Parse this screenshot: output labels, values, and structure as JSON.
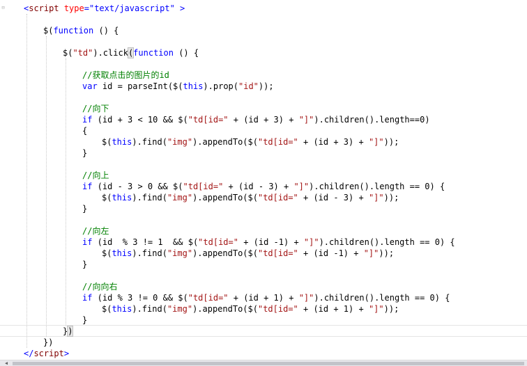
{
  "editor": {
    "lines": [
      {
        "id": "l1",
        "indent": 1,
        "segments": [
          {
            "t": "<",
            "c": "t-punct"
          },
          {
            "t": "script",
            "c": "t-tag"
          },
          {
            "t": " ",
            "c": "t-plain"
          },
          {
            "t": "type",
            "c": "t-attr"
          },
          {
            "t": "=",
            "c": "t-punct"
          },
          {
            "t": "\"text/javascript\"",
            "c": "t-attrval"
          },
          {
            "t": " >",
            "c": "t-punct"
          }
        ]
      },
      {
        "id": "l2",
        "indent": 0,
        "segments": []
      },
      {
        "id": "l3",
        "indent": 2,
        "segments": [
          {
            "t": "$(",
            "c": "t-plain"
          },
          {
            "t": "function",
            "c": "t-keyword"
          },
          {
            "t": " () {",
            "c": "t-plain"
          }
        ]
      },
      {
        "id": "l4",
        "indent": 0,
        "segments": []
      },
      {
        "id": "l5",
        "indent": 3,
        "segments": [
          {
            "t": "$(",
            "c": "t-plain"
          },
          {
            "t": "\"td\"",
            "c": "t-string"
          },
          {
            "t": ").click",
            "c": "t-plain"
          },
          {
            "t": "(",
            "c": "t-plain",
            "hl": true
          },
          {
            "t": "function",
            "c": "t-keyword"
          },
          {
            "t": " () {",
            "c": "t-plain"
          }
        ]
      },
      {
        "id": "l6",
        "indent": 0,
        "segments": []
      },
      {
        "id": "l7",
        "indent": 4,
        "segments": [
          {
            "t": "//获取点击的图片的id",
            "c": "t-comment"
          }
        ]
      },
      {
        "id": "l8",
        "indent": 4,
        "segments": [
          {
            "t": "var",
            "c": "t-keyword"
          },
          {
            "t": " id = parseInt($(",
            "c": "t-plain"
          },
          {
            "t": "this",
            "c": "t-keyword"
          },
          {
            "t": ").prop(",
            "c": "t-plain"
          },
          {
            "t": "\"id\"",
            "c": "t-string"
          },
          {
            "t": "));",
            "c": "t-plain"
          }
        ]
      },
      {
        "id": "l9",
        "indent": 0,
        "segments": []
      },
      {
        "id": "l10",
        "indent": 4,
        "segments": [
          {
            "t": "//向下",
            "c": "t-comment"
          }
        ]
      },
      {
        "id": "l11",
        "indent": 4,
        "segments": [
          {
            "t": "if",
            "c": "t-keyword"
          },
          {
            "t": " (id + 3 < 10 && $(",
            "c": "t-plain"
          },
          {
            "t": "\"td[id=\"",
            "c": "t-string"
          },
          {
            "t": " + (id + 3) + ",
            "c": "t-plain"
          },
          {
            "t": "\"]\"",
            "c": "t-string"
          },
          {
            "t": ").children().length==0)",
            "c": "t-plain"
          }
        ]
      },
      {
        "id": "l12",
        "indent": 4,
        "segments": [
          {
            "t": "{",
            "c": "t-plain"
          }
        ]
      },
      {
        "id": "l13",
        "indent": 5,
        "segments": [
          {
            "t": "$(",
            "c": "t-plain"
          },
          {
            "t": "this",
            "c": "t-keyword"
          },
          {
            "t": ").find(",
            "c": "t-plain"
          },
          {
            "t": "\"img\"",
            "c": "t-string"
          },
          {
            "t": ").appendTo($(",
            "c": "t-plain"
          },
          {
            "t": "\"td[id=\"",
            "c": "t-string"
          },
          {
            "t": " + (id + 3) + ",
            "c": "t-plain"
          },
          {
            "t": "\"]\"",
            "c": "t-string"
          },
          {
            "t": "));",
            "c": "t-plain"
          }
        ]
      },
      {
        "id": "l14",
        "indent": 4,
        "segments": [
          {
            "t": "}",
            "c": "t-plain"
          }
        ]
      },
      {
        "id": "l15",
        "indent": 0,
        "segments": []
      },
      {
        "id": "l16",
        "indent": 4,
        "segments": [
          {
            "t": "//向上",
            "c": "t-comment"
          }
        ]
      },
      {
        "id": "l17",
        "indent": 4,
        "segments": [
          {
            "t": "if",
            "c": "t-keyword"
          },
          {
            "t": " (id - 3 > 0 && $(",
            "c": "t-plain"
          },
          {
            "t": "\"td[id=\"",
            "c": "t-string"
          },
          {
            "t": " + (id - 3) + ",
            "c": "t-plain"
          },
          {
            "t": "\"]\"",
            "c": "t-string"
          },
          {
            "t": ").children().length == 0) {",
            "c": "t-plain"
          }
        ]
      },
      {
        "id": "l18",
        "indent": 5,
        "segments": [
          {
            "t": "$(",
            "c": "t-plain"
          },
          {
            "t": "this",
            "c": "t-keyword"
          },
          {
            "t": ").find(",
            "c": "t-plain"
          },
          {
            "t": "\"img\"",
            "c": "t-string"
          },
          {
            "t": ").appendTo($(",
            "c": "t-plain"
          },
          {
            "t": "\"td[id=\"",
            "c": "t-string"
          },
          {
            "t": " + (id - 3) + ",
            "c": "t-plain"
          },
          {
            "t": "\"]\"",
            "c": "t-string"
          },
          {
            "t": "));",
            "c": "t-plain"
          }
        ]
      },
      {
        "id": "l19",
        "indent": 4,
        "segments": [
          {
            "t": "}",
            "c": "t-plain"
          }
        ]
      },
      {
        "id": "l20",
        "indent": 0,
        "segments": []
      },
      {
        "id": "l21",
        "indent": 4,
        "segments": [
          {
            "t": "//向左",
            "c": "t-comment"
          }
        ]
      },
      {
        "id": "l22",
        "indent": 4,
        "segments": [
          {
            "t": "if",
            "c": "t-keyword"
          },
          {
            "t": " (id  % 3 != 1  && $(",
            "c": "t-plain"
          },
          {
            "t": "\"td[id=\"",
            "c": "t-string"
          },
          {
            "t": " + (id -1) + ",
            "c": "t-plain"
          },
          {
            "t": "\"]\"",
            "c": "t-string"
          },
          {
            "t": ").children().length == 0) {",
            "c": "t-plain"
          }
        ]
      },
      {
        "id": "l23",
        "indent": 5,
        "segments": [
          {
            "t": "$(",
            "c": "t-plain"
          },
          {
            "t": "this",
            "c": "t-keyword"
          },
          {
            "t": ").find(",
            "c": "t-plain"
          },
          {
            "t": "\"img\"",
            "c": "t-string"
          },
          {
            "t": ").appendTo($(",
            "c": "t-plain"
          },
          {
            "t": "\"td[id=\"",
            "c": "t-string"
          },
          {
            "t": " + (id -1) + ",
            "c": "t-plain"
          },
          {
            "t": "\"]\"",
            "c": "t-string"
          },
          {
            "t": "));",
            "c": "t-plain"
          }
        ]
      },
      {
        "id": "l24",
        "indent": 4,
        "segments": [
          {
            "t": "}",
            "c": "t-plain"
          }
        ]
      },
      {
        "id": "l25",
        "indent": 0,
        "segments": []
      },
      {
        "id": "l26",
        "indent": 4,
        "segments": [
          {
            "t": "//向向右",
            "c": "t-comment"
          }
        ]
      },
      {
        "id": "l27",
        "indent": 4,
        "segments": [
          {
            "t": "if",
            "c": "t-keyword"
          },
          {
            "t": " (id % 3 != 0 && $(",
            "c": "t-plain"
          },
          {
            "t": "\"td[id=\"",
            "c": "t-string"
          },
          {
            "t": " + (id + 1) + ",
            "c": "t-plain"
          },
          {
            "t": "\"]\"",
            "c": "t-string"
          },
          {
            "t": ").children().length == 0) {",
            "c": "t-plain"
          }
        ]
      },
      {
        "id": "l28",
        "indent": 5,
        "segments": [
          {
            "t": "$(",
            "c": "t-plain"
          },
          {
            "t": "this",
            "c": "t-keyword"
          },
          {
            "t": ").find(",
            "c": "t-plain"
          },
          {
            "t": "\"img\"",
            "c": "t-string"
          },
          {
            "t": ").appendTo($(",
            "c": "t-plain"
          },
          {
            "t": "\"td[id=\"",
            "c": "t-string"
          },
          {
            "t": " + (id + 1) + ",
            "c": "t-plain"
          },
          {
            "t": "\"]\"",
            "c": "t-string"
          },
          {
            "t": "));",
            "c": "t-plain"
          }
        ]
      },
      {
        "id": "l29",
        "indent": 4,
        "segments": [
          {
            "t": "}",
            "c": "t-plain"
          }
        ]
      },
      {
        "id": "l30",
        "indent": 3,
        "segments": [
          {
            "t": "}",
            "c": "t-plain"
          },
          {
            "t": ")",
            "c": "t-plain",
            "hl": true
          }
        ]
      },
      {
        "id": "l31",
        "indent": 2,
        "segments": [
          {
            "t": "})",
            "c": "t-plain"
          }
        ]
      },
      {
        "id": "l32",
        "indent": 1,
        "segments": [
          {
            "t": "</",
            "c": "t-punct"
          },
          {
            "t": "script",
            "c": "t-tag"
          },
          {
            "t": ">",
            "c": "t-punct"
          }
        ]
      }
    ]
  },
  "colors": {
    "keyword": "#0000ff",
    "string": "#a31515",
    "comment": "#008000",
    "tag": "#800000",
    "attribute": "#ff0000"
  },
  "icons": {
    "fold_marker": "minus-box-icon",
    "scroll_left": "arrow-left-icon"
  }
}
